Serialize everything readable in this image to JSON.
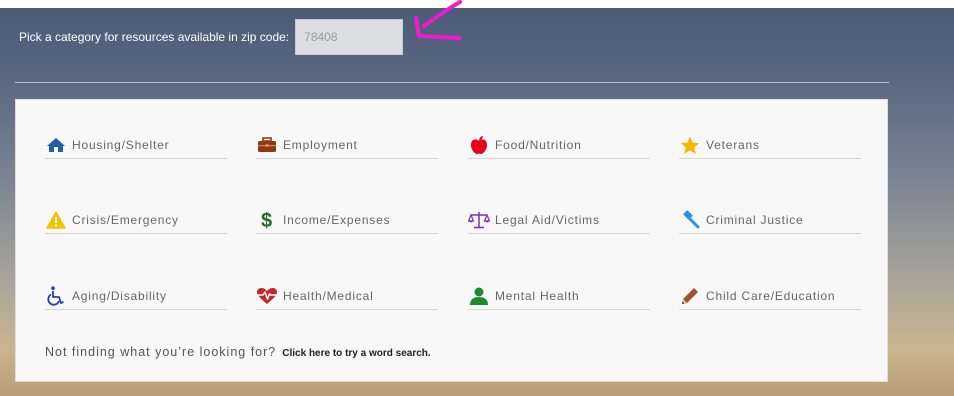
{
  "zip": {
    "label": "Pick a category for resources available in zip code:",
    "value": "78408"
  },
  "categories": [
    {
      "label": "Housing/Shelter",
      "icon": "home-icon",
      "color": "#1f5fa8"
    },
    {
      "label": "Employment",
      "icon": "briefcase-icon",
      "color": "#8b3a16"
    },
    {
      "label": "Food/Nutrition",
      "icon": "apple-icon",
      "color": "#e8001a"
    },
    {
      "label": "Veterans",
      "icon": "star-icon",
      "color": "#f5b700"
    },
    {
      "label": "Crisis/Emergency",
      "icon": "warning-icon",
      "color": "#f5c200"
    },
    {
      "label": "Income/Expenses",
      "icon": "dollar-icon",
      "color": "#1d6b2d"
    },
    {
      "label": "Legal Aid/Victims",
      "icon": "scales-icon",
      "color": "#7b2fb8"
    },
    {
      "label": "Criminal Justice",
      "icon": "gavel-icon",
      "color": "#2a8ff0"
    },
    {
      "label": "Aging/Disability",
      "icon": "wheelchair-icon",
      "color": "#1f3fb8"
    },
    {
      "label": "Health/Medical",
      "icon": "heart-pulse-icon",
      "color": "#c2282c"
    },
    {
      "label": "Mental Health",
      "icon": "person-icon",
      "color": "#1d8a2b"
    },
    {
      "label": "Child Care/Education",
      "icon": "pencil-icon",
      "color": "#a0522d"
    }
  ],
  "footer": {
    "text": "Not finding what you’re looking for?",
    "link": "Click here to try a word search."
  }
}
